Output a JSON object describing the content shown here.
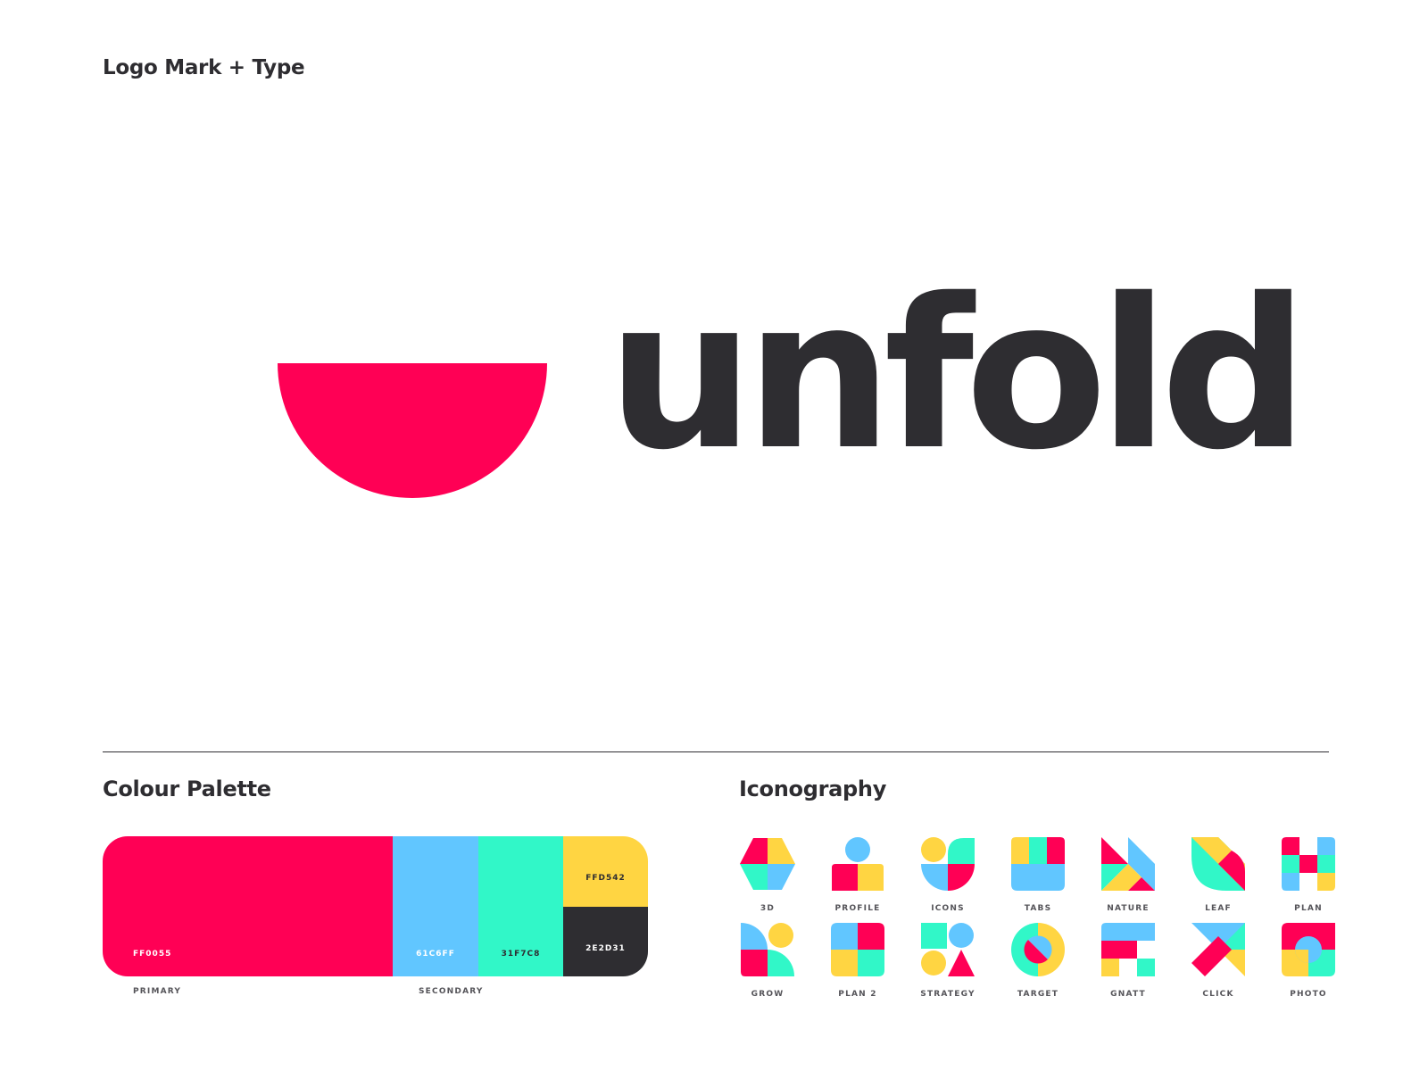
{
  "sections": {
    "logo_title": "Logo Mark + Type",
    "palette_title": "Colour Palette",
    "icon_title": "Iconography"
  },
  "logo": {
    "wordmark": "unfold",
    "mark_color": "#FF0055",
    "text_color": "#2E2D31"
  },
  "palette": {
    "primary_label": "PRIMARY",
    "secondary_label": "SECONDARY",
    "swatches": [
      {
        "code": "FF0055",
        "color": "#FF0055"
      },
      {
        "code": "61C6FF",
        "color": "#61C6FF"
      },
      {
        "code": "31F7C8",
        "color": "#31F7C8"
      },
      {
        "code": "FFD542",
        "color": "#FFD542"
      },
      {
        "code": "2E2D31",
        "color": "#2E2D31"
      }
    ]
  },
  "icons": [
    {
      "label": "3D",
      "icon": "3d-icon"
    },
    {
      "label": "PROFILE",
      "icon": "profile-icon"
    },
    {
      "label": "ICONS",
      "icon": "icons-icon"
    },
    {
      "label": "TABS",
      "icon": "tabs-icon"
    },
    {
      "label": "NATURE",
      "icon": "nature-icon"
    },
    {
      "label": "LEAF",
      "icon": "leaf-icon"
    },
    {
      "label": "PLAN",
      "icon": "plan-icon"
    },
    {
      "label": "GROW",
      "icon": "grow-icon"
    },
    {
      "label": "PLAN 2",
      "icon": "plan-2-icon"
    },
    {
      "label": "STRATEGY",
      "icon": "strategy-icon"
    },
    {
      "label": "TARGET",
      "icon": "target-icon"
    },
    {
      "label": "GNATT",
      "icon": "gnatt-icon"
    },
    {
      "label": "CLICK",
      "icon": "click-icon"
    },
    {
      "label": "PHOTO",
      "icon": "photo-icon"
    }
  ]
}
